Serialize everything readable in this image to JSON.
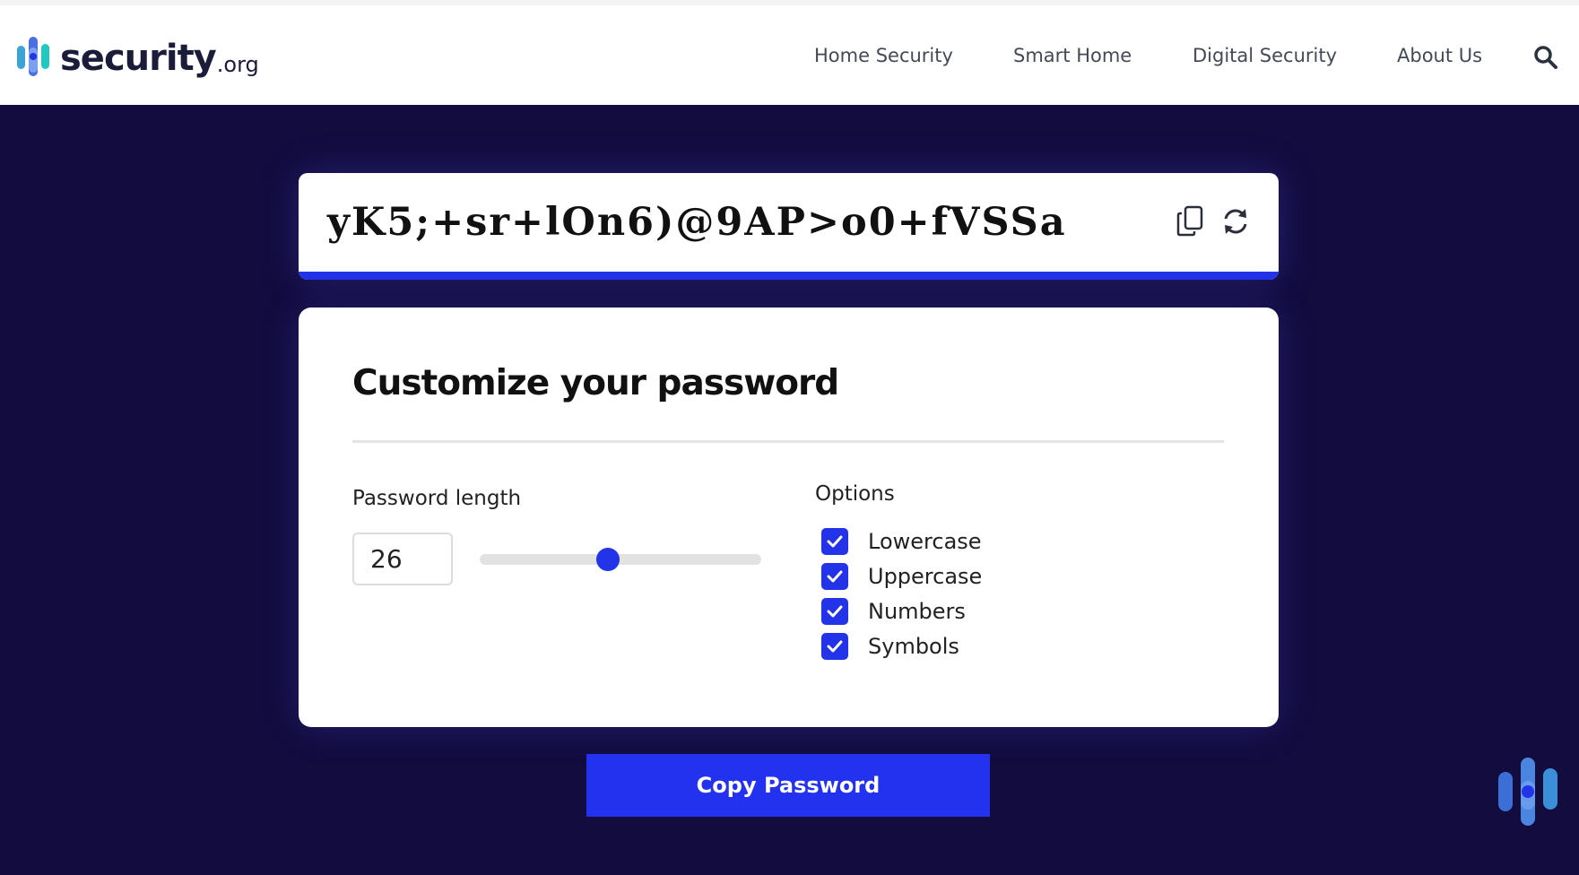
{
  "header": {
    "logo": {
      "word": "security",
      "tld": ".org"
    },
    "nav": [
      {
        "label": "Home Security"
      },
      {
        "label": "Smart Home"
      },
      {
        "label": "Digital Security"
      },
      {
        "label": "About Us"
      }
    ],
    "search_icon": "search-icon"
  },
  "password_display": {
    "value": "yK5;+sr+lOn6)@9AP>o0+fVSSa",
    "copy_icon": "copy-icon",
    "refresh_icon": "refresh-icon"
  },
  "customize": {
    "title": "Customize your password",
    "length_label": "Password length",
    "length_value": "26",
    "slider": {
      "min": 6,
      "max": 50,
      "value": 26
    },
    "options_label": "Options",
    "options": [
      {
        "label": "Lowercase",
        "checked": true
      },
      {
        "label": "Uppercase",
        "checked": true
      },
      {
        "label": "Numbers",
        "checked": true
      },
      {
        "label": "Symbols",
        "checked": true
      }
    ]
  },
  "copy_button": {
    "label": "Copy Password"
  },
  "colors": {
    "background": "#120c3f",
    "accent": "#2233e8",
    "header_bg": "#ffffff",
    "card_bg": "#ffffff"
  }
}
